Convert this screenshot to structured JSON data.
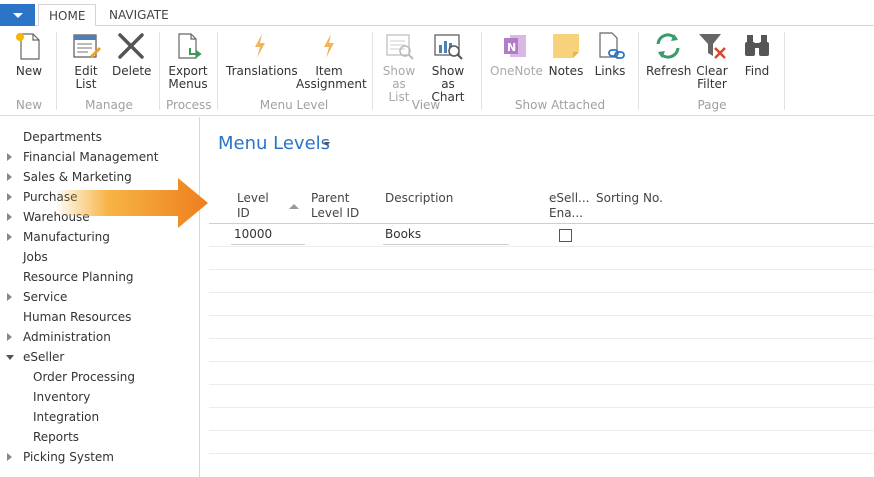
{
  "tabs": {
    "home": "HOME",
    "navigate": "NAVIGATE"
  },
  "ribbon": {
    "new": "New",
    "edit_list_1": "Edit",
    "edit_list_2": "List",
    "delete": "Delete",
    "export_menus_1": "Export",
    "export_menus_2": "Menus",
    "translations": "Translations",
    "item_assignment_1": "Item",
    "item_assignment_2": "Assignment",
    "show_as_list_1": "Show",
    "show_as_list_2": "as List",
    "show_as_chart_1": "Show as",
    "show_as_chart_2": "Chart",
    "onenote": "OneNote",
    "notes": "Notes",
    "links": "Links",
    "refresh": "Refresh",
    "clear_filter_1": "Clear",
    "clear_filter_2": "Filter",
    "find": "Find",
    "groups": {
      "new": "New",
      "manage": "Manage",
      "process": "Process",
      "menu_level": "Menu Level",
      "view": "View",
      "show_attached": "Show Attached",
      "page": "Page"
    }
  },
  "nav": {
    "items": [
      {
        "label": "Departments"
      },
      {
        "label": "Financial Management"
      },
      {
        "label": "Sales & Marketing"
      },
      {
        "label": "Purchase"
      },
      {
        "label": "Warehouse"
      },
      {
        "label": "Manufacturing"
      },
      {
        "label": "Jobs"
      },
      {
        "label": "Resource Planning"
      },
      {
        "label": "Service"
      },
      {
        "label": "Human Resources"
      },
      {
        "label": "Administration"
      },
      {
        "label": "eSeller"
      },
      {
        "label": "Order Processing"
      },
      {
        "label": "Inventory"
      },
      {
        "label": "Integration"
      },
      {
        "label": "Reports"
      },
      {
        "label": "Picking System"
      }
    ]
  },
  "page": {
    "title": "Menu Levels"
  },
  "table": {
    "columns": {
      "level_id_1": "Level",
      "level_id_2": "ID",
      "parent_level_id_1": "Parent",
      "parent_level_id_2": "Level ID",
      "description": "Description",
      "eseller_enabled_1": "eSell...",
      "eseller_enabled_2": "Ena...",
      "sorting_no": "Sorting No."
    },
    "rows": [
      {
        "level_id": "10000",
        "parent_level_id": "",
        "description": "Books",
        "eseller_enabled": false,
        "sorting_no": ""
      }
    ]
  },
  "colors": {
    "accent": "#2b74c7",
    "arrow": "#f08a24"
  }
}
